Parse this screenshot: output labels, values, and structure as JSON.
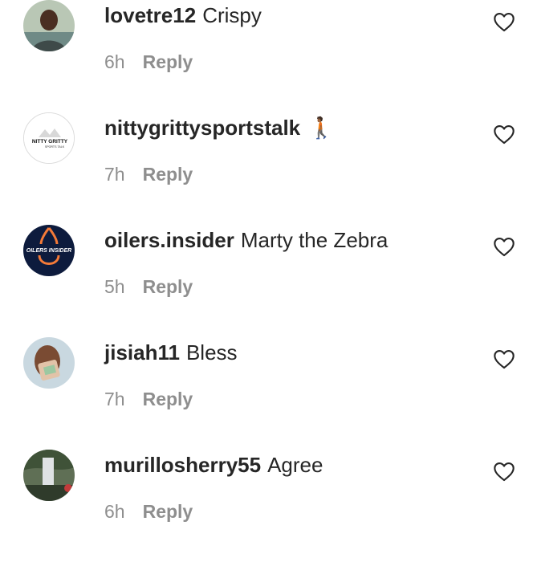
{
  "comments": [
    {
      "username": "lovetre12",
      "text": "Crispy",
      "time": "6h",
      "reply_label": "Reply",
      "avatar_icon": "profile-photo",
      "like_icon": "heart-outline-icon"
    },
    {
      "username": "nittygrittysportstalk",
      "text": "🚶🏾",
      "time": "7h",
      "reply_label": "Reply",
      "avatar_icon": "nitty-gritty-logo",
      "avatar_logo_text": "NITTY GRITTY",
      "avatar_logo_subtext": "SPORTS TALK",
      "like_icon": "heart-outline-icon"
    },
    {
      "username": "oilers.insider",
      "text": "Marty the Zebra",
      "time": "5h",
      "reply_label": "Reply",
      "avatar_icon": "oilers-insider-logo",
      "avatar_logo_text": "OILERS INSIDER",
      "like_icon": "heart-outline-icon"
    },
    {
      "username": "jisiah11",
      "text": "Bless",
      "time": "7h",
      "reply_label": "Reply",
      "avatar_icon": "profile-photo",
      "like_icon": "heart-outline-icon"
    },
    {
      "username": "murillosherry55",
      "text": "Agree",
      "time": "6h",
      "reply_label": "Reply",
      "avatar_icon": "profile-photo",
      "like_icon": "heart-outline-icon"
    }
  ],
  "colors": {
    "text_primary": "#262626",
    "text_secondary": "#8e8e8e",
    "oilers_navy": "#0d1b3d",
    "oilers_orange": "#f47a38"
  }
}
